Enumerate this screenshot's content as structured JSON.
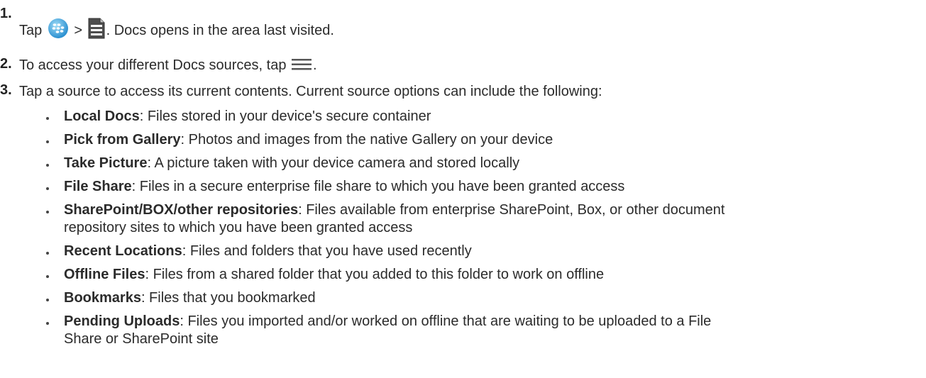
{
  "steps": [
    {
      "number": "1.",
      "parts": [
        "Tap",
        ">",
        ". Docs opens in the area last visited."
      ]
    },
    {
      "number": "2.",
      "parts": [
        "To access your different Docs sources, tap",
        "."
      ]
    },
    {
      "number": "3.",
      "text": "Tap a source to access its current contents. Current source options can include the following:"
    }
  ],
  "icons": {
    "step1_first": "blackberry-dynamics-icon",
    "step1_second": "docs-file-icon",
    "step2": "menu-icon"
  },
  "sources": [
    {
      "name": "Local Docs",
      "desc": ": Files stored in your device's secure container"
    },
    {
      "name": "Pick from Gallery",
      "desc": ": Photos and images from the native Gallery on your device"
    },
    {
      "name": "Take Picture",
      "desc": ": A picture taken with your device camera and stored locally"
    },
    {
      "name": "File Share",
      "desc": ": Files in a secure enterprise file share to which you have been granted access"
    },
    {
      "name": "SharePoint/BOX/other repositories",
      "desc": ": Files available from enterprise SharePoint, Box, or other document",
      "desc2": "repository sites to which you have been granted access"
    },
    {
      "name": "Recent Locations",
      "desc": ": Files and folders that you have used recently"
    },
    {
      "name": "Offline Files",
      "desc": ": Files from a shared folder that you added to this folder to work on offline"
    },
    {
      "name": "Bookmarks",
      "desc": ": Files that you bookmarked"
    },
    {
      "name": "Pending Uploads",
      "desc": ": Files you imported and/or worked on offline that are waiting to be uploaded to a File",
      "desc2": "Share or SharePoint site"
    }
  ]
}
